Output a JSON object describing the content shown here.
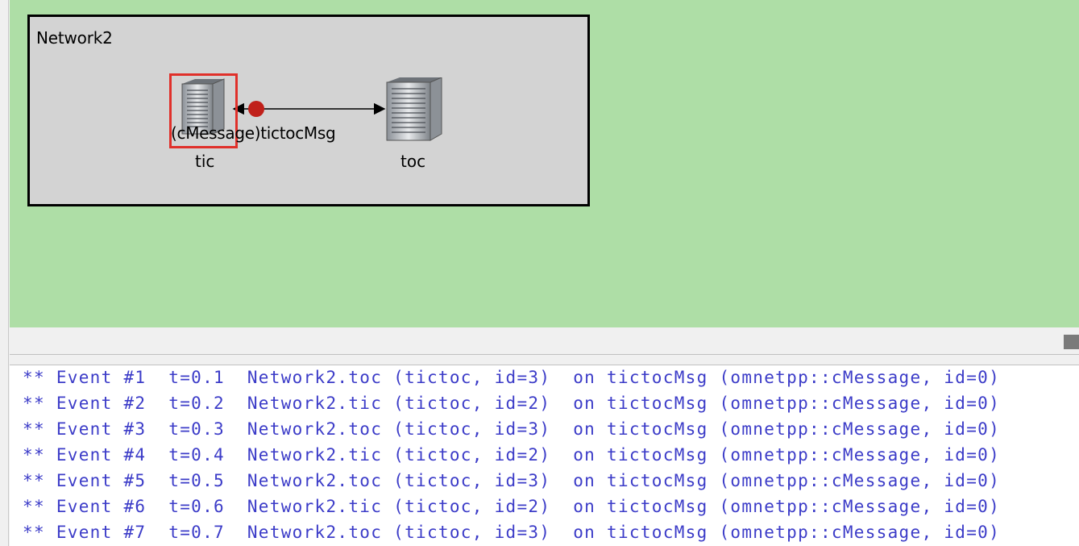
{
  "network": {
    "title": "Network2",
    "modules": [
      {
        "name": "tic",
        "selected": true
      },
      {
        "name": "toc",
        "selected": false
      }
    ],
    "message_label": "(cMessage)tictocMsg",
    "message_color": "#c0201a",
    "selection_color": "#e0302a"
  },
  "colors": {
    "canvas_bg": "#aedea6",
    "network_bg": "#d3d3d3",
    "log_text": "#3c3cc8"
  },
  "log": {
    "lines": [
      "** Event #1  t=0.1  Network2.toc (tictoc, id=3)  on tictocMsg (omnetpp::cMessage, id=0)",
      "** Event #2  t=0.2  Network2.tic (tictoc, id=2)  on tictocMsg (omnetpp::cMessage, id=0)",
      "** Event #3  t=0.3  Network2.toc (tictoc, id=3)  on tictocMsg (omnetpp::cMessage, id=0)",
      "** Event #4  t=0.4  Network2.tic (tictoc, id=2)  on tictocMsg (omnetpp::cMessage, id=0)",
      "** Event #5  t=0.5  Network2.toc (tictoc, id=3)  on tictocMsg (omnetpp::cMessage, id=0)",
      "** Event #6  t=0.6  Network2.tic (tictoc, id=2)  on tictocMsg (omnetpp::cMessage, id=0)",
      "** Event #7  t=0.7  Network2.toc (tictoc, id=3)  on tictocMsg (omnetpp::cMessage, id=0)"
    ]
  }
}
